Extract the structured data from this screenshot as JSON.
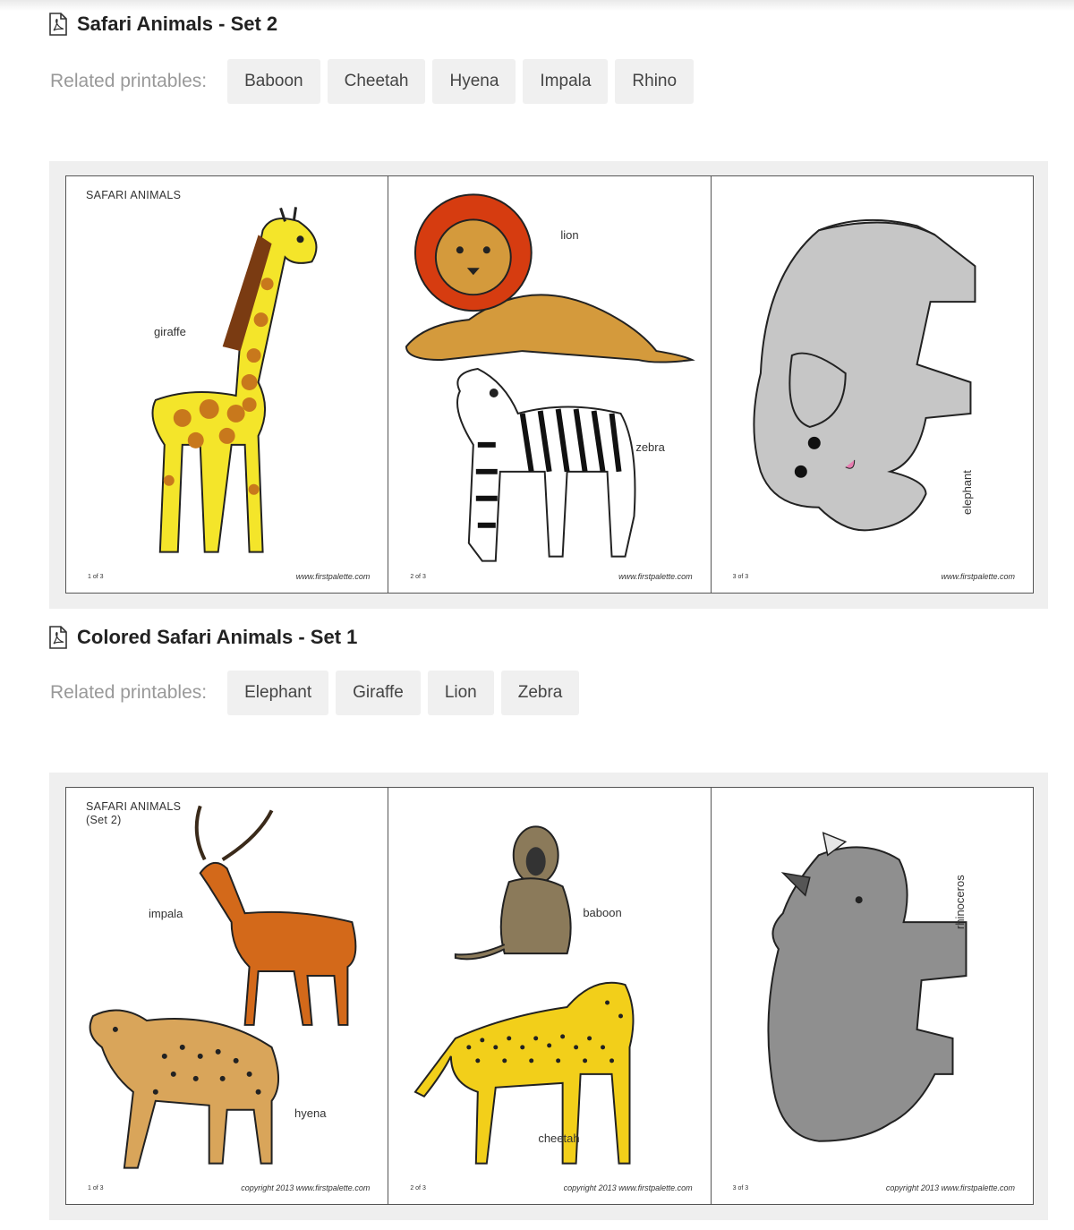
{
  "section1": {
    "title": "Safari Animals - Set 2",
    "related_label": "Related printables:",
    "tags": [
      "Baboon",
      "Cheetah",
      "Hyena",
      "Impala",
      "Rhino"
    ],
    "preview": {
      "heading": "SAFARI ANIMALS",
      "labels": {
        "giraffe": "giraffe",
        "lion": "lion",
        "zebra": "zebra",
        "elephant": "elephant"
      },
      "page_numbers": [
        "1 of 3",
        "2 of 3",
        "3 of 3"
      ],
      "credit": "www.firstpalette.com"
    }
  },
  "section2": {
    "title": "Colored Safari Animals - Set 1",
    "related_label": "Related printables:",
    "tags": [
      "Elephant",
      "Giraffe",
      "Lion",
      "Zebra"
    ],
    "preview": {
      "heading_line1": "SAFARI ANIMALS",
      "heading_line2": "(Set 2)",
      "labels": {
        "impala": "impala",
        "hyena": "hyena",
        "baboon": "baboon",
        "cheetah": "cheetah",
        "rhinoceros": "rhinoceros"
      },
      "page_numbers": [
        "1 of 3",
        "2 of 3",
        "3 of 3"
      ],
      "credit": "copyright 2013 www.firstpalette.com"
    }
  },
  "icons": {
    "title_icon": "pdf-file-icon"
  },
  "colors": {
    "tag_bg": "#f0f0f0",
    "preview_bg": "#efefef",
    "label_gray": "#999999"
  }
}
